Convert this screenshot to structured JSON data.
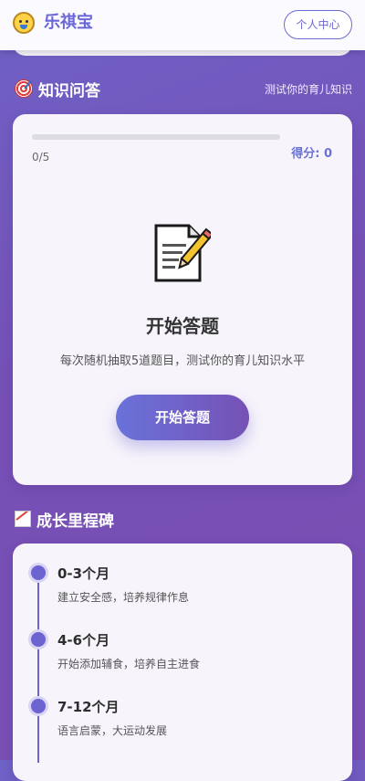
{
  "header": {
    "app_name": "乐祺宝",
    "user_center_label": "个人中心"
  },
  "quiz_section": {
    "title": "知识问答",
    "subtitle": "测试你的育儿知识",
    "progress_text": "0/5",
    "progress_fraction": 0,
    "score_text": "得分: 0",
    "heading": "开始答题",
    "description": "每次随机抽取5道题目，测试你的育儿知识水平",
    "start_button_label": "开始答题"
  },
  "milestone_section": {
    "title": "成长里程碑",
    "items": [
      {
        "title": "0-3个月",
        "description": "建立安全感，培养规律作息"
      },
      {
        "title": "4-6个月",
        "description": "开始添加辅食，培养自主进食"
      },
      {
        "title": "7-12个月",
        "description": "语言启蒙，大运动发展"
      }
    ]
  },
  "icons": {
    "brand": "baby-face-icon",
    "quiz": "target-icon",
    "memo": "memo-icon",
    "milestone": "chart-increasing-icon"
  },
  "colors": {
    "accent": "#6b63d0",
    "brand_text": "#6a67d8",
    "score_text": "#6a72d4"
  }
}
